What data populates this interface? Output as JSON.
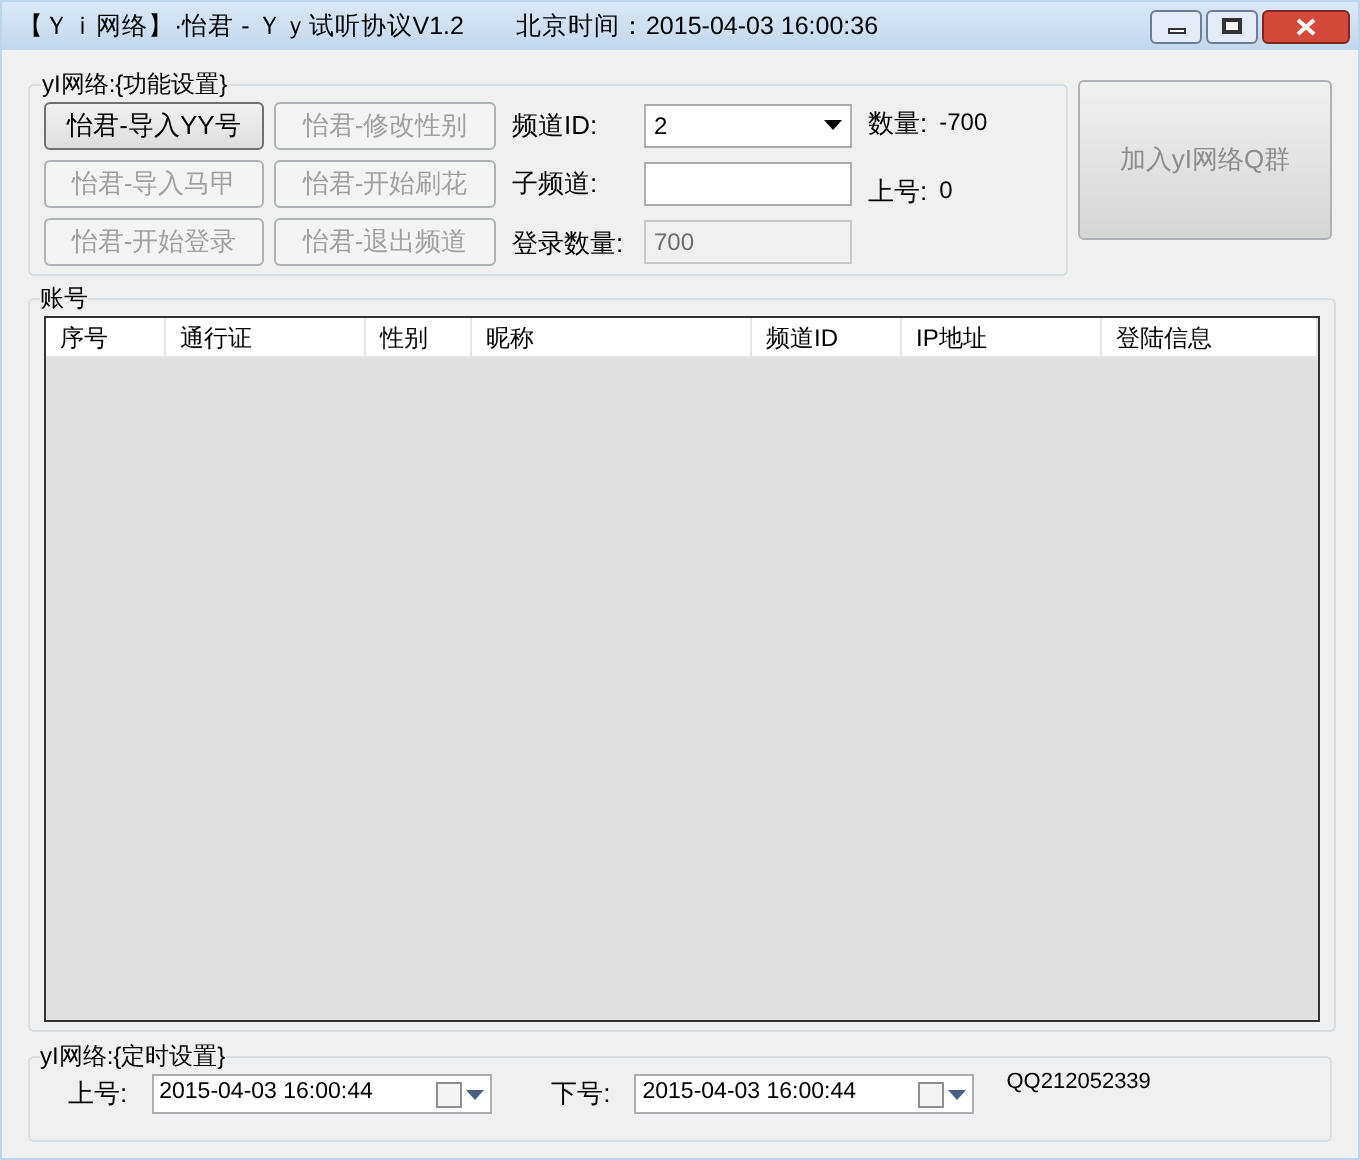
{
  "window": {
    "title": "【Ｙｉ网络】·怡君 - Ｙｙ试听协议V1.2　　北京时间：2015-04-03 16:00:36"
  },
  "function_group": {
    "title": "yI网络:{功能设置}",
    "buttons": [
      {
        "label": "怡君-导入YY号",
        "disabled": false
      },
      {
        "label": "怡君-修改性别",
        "disabled": true
      },
      {
        "label": "怡君-导入马甲",
        "disabled": true
      },
      {
        "label": "怡君-开始刷花",
        "disabled": true
      },
      {
        "label": "怡君-开始登录",
        "disabled": true
      },
      {
        "label": "怡君-退出频道",
        "disabled": true
      }
    ],
    "fields": [
      {
        "kind": "dropdown",
        "label": "频道ID:",
        "value": "2",
        "disabled": false
      },
      {
        "kind": "text",
        "label": "子频道:",
        "disabled": false
      },
      {
        "kind": "text",
        "label": "登录数量:",
        "value": "700",
        "disabled": true
      }
    ],
    "stats": [
      {
        "label": "数量:",
        "value": "-700"
      },
      {
        "label": "上号:",
        "value": "0"
      }
    ],
    "join_button": {
      "label": "加入yI网络Q群",
      "disabled": true
    }
  },
  "accounts_group": {
    "title": "账号",
    "table": {
      "columns": [
        "序号",
        "通行证",
        "性别",
        "昵称",
        "频道ID",
        "IP地址",
        "登陆信息"
      ]
    }
  },
  "timer_group": {
    "title": "yI网络:{定时设置}",
    "pickers": [
      {
        "label": "上号:",
        "value": "2015-04-03 16:00:44",
        "checked": false
      },
      {
        "label": "下号:",
        "value": "2015-04-03 16:00:44",
        "checked": false
      }
    ],
    "qq": "QQ212052339"
  }
}
